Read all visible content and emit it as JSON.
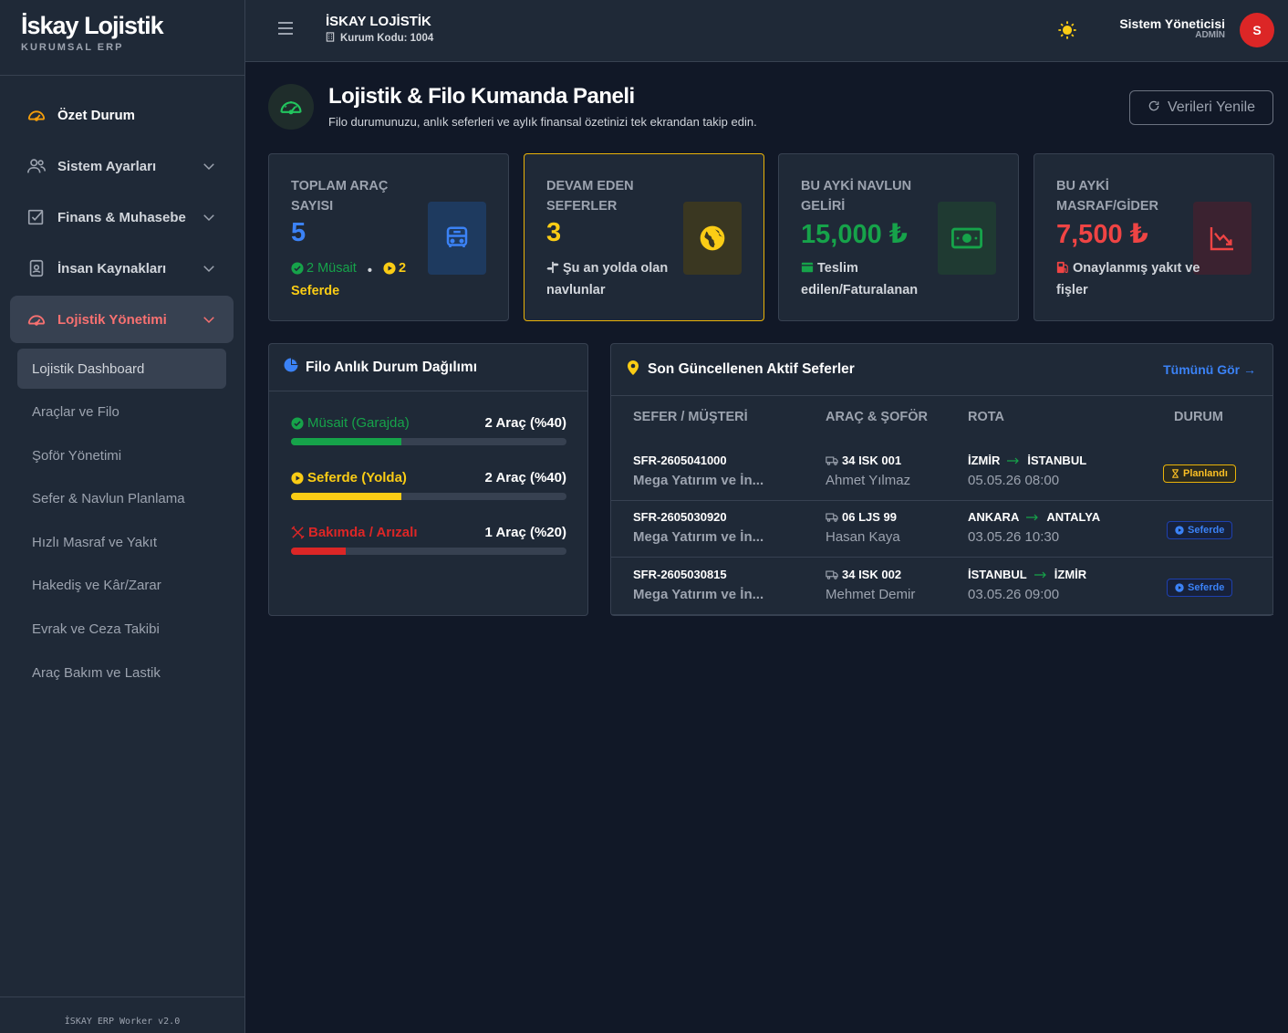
{
  "brand": {
    "title": "İskay Lojistik",
    "subtitle": "KURUMSAL ERP"
  },
  "sidebar": {
    "items": [
      {
        "label": "Özet Durum",
        "icon": "gauge-icon"
      },
      {
        "label": "Sistem Ayarları",
        "icon": "users-icon"
      },
      {
        "label": "Finans & Muhasebe",
        "icon": "checkbox-icon"
      },
      {
        "label": "İnsan Kaynakları",
        "icon": "id-badge-icon"
      },
      {
        "label": "Lojistik Yönetimi",
        "icon": "gauge-icon"
      }
    ],
    "subitems": [
      "Lojistik Dashboard",
      "Araçlar ve Filo",
      "Şoför Yönetimi",
      "Sefer & Navlun Planlama",
      "Hızlı Masraf ve Yakıt",
      "Hakediş ve Kâr/Zarar",
      "Evrak ve Ceza Takibi",
      "Araç Bakım ve Lastik"
    ],
    "footer": "İSKAY ERP Worker v2.0"
  },
  "header": {
    "company": "İSKAY LOJİSTİK",
    "code": "Kurum Kodu: 1004",
    "user_name": "Sistem Yöneticisi",
    "user_role": "ADMİN",
    "avatar_initial": "S"
  },
  "page": {
    "title": "Lojistik & Filo Kumanda Paneli",
    "subtitle": "Filo durumunuzu, anlık seferleri ve aylık finansal özetinizi tek ekrandan takip edin.",
    "refresh_label": "Verileri Yenile"
  },
  "cards": [
    {
      "title": "TOPLAM ARAÇ SAYISI",
      "value": "5",
      "available": "2 Müsait",
      "dot": "•",
      "on_road": "2",
      "on_road_label": "Seferde",
      "color": "#3b82f6"
    },
    {
      "title": "DEVAM EDEN SEFERLER",
      "value": "3",
      "note": "Şu an yolda olan navlunlar",
      "color": "#facc15"
    },
    {
      "title": "BU AYKİ NAVLUN GELİRİ",
      "value": "15,000 ₺",
      "note": "Teslim edilen/Faturalanan",
      "color": "#16a34a"
    },
    {
      "title": "BU AYKİ MASRAF/GİDER",
      "value": "7,500 ₺",
      "note": "Onaylanmış yakıt ve fişler",
      "color": "#ef4444"
    }
  ],
  "fleet": {
    "title": "Filo Anlık Durum Dağılımı",
    "rows": [
      {
        "label": "Müsait (Garajda)",
        "count": "2 Araç (%40)",
        "percent": 40,
        "color": "#16a34a"
      },
      {
        "label": "Seferde (Yolda)",
        "count": "2 Araç (%40)",
        "percent": 40,
        "color": "#facc15"
      },
      {
        "label": "Bakımda / Arızalı",
        "count": "1 Araç (%20)",
        "percent": 20,
        "color": "#dc2626"
      }
    ]
  },
  "trips": {
    "title": "Son Güncellenen Aktif Seferler",
    "see_all": "Tümünü Gör →",
    "columns": [
      "SEFER / MÜŞTERİ",
      "ARAÇ & ŞOFÖR",
      "ROTA",
      "DURUM"
    ],
    "rows": [
      {
        "code": "SFR-2605041000",
        "customer": "Mega Yatırım ve İn...",
        "plate": "34 ISK 001",
        "driver": "Ahmet Yılmaz",
        "from": "İZMİR",
        "to": "İSTANBUL",
        "date": "05.05.26 08:00",
        "status": "Planlandı",
        "type": "plan"
      },
      {
        "code": "SFR-2605030920",
        "customer": "Mega Yatırım ve İn...",
        "plate": "06 LJS 99",
        "driver": "Hasan Kaya",
        "from": "ANKARA",
        "to": "ANTALYA",
        "date": "03.05.26 10:30",
        "status": "Seferde",
        "type": "road"
      },
      {
        "code": "SFR-2605030815",
        "customer": "Mega Yatırım ve İn...",
        "plate": "34 ISK 002",
        "driver": "Mehmet Demir",
        "from": "İSTANBUL",
        "to": "İZMİR",
        "date": "03.05.26 09:00",
        "status": "Seferde",
        "type": "road"
      }
    ]
  }
}
